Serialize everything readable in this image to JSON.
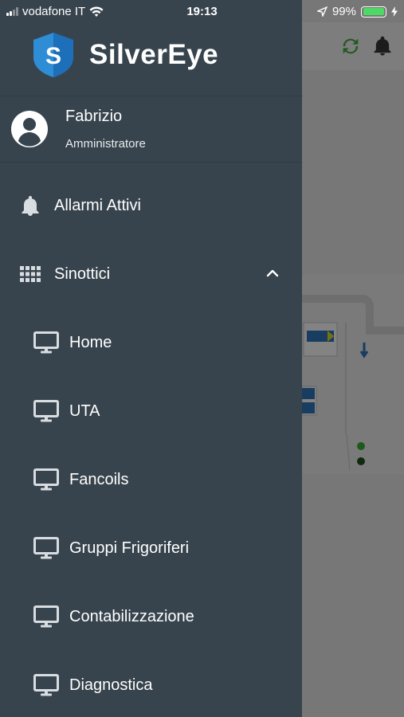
{
  "status_bar": {
    "carrier": "vodafone IT",
    "time": "19:13",
    "battery": "99%",
    "battery_level": 0.99
  },
  "app": {
    "name": "SilverEye",
    "logo_letter": "S"
  },
  "user": {
    "name": "Fabrizio",
    "role": "Amministratore"
  },
  "menu": {
    "alarms": {
      "label": "Allarmi Attivi",
      "icon": "bell-icon"
    },
    "synoptics": {
      "label": "Sinottici",
      "icon": "grid-icon",
      "expanded": true,
      "items": [
        {
          "label": "Home",
          "icon": "monitor-icon"
        },
        {
          "label": "UTA",
          "icon": "monitor-icon"
        },
        {
          "label": "Fancoils",
          "icon": "monitor-icon"
        },
        {
          "label": "Gruppi Frigoriferi",
          "icon": "monitor-icon"
        },
        {
          "label": "Contabilizzazione",
          "icon": "monitor-icon"
        },
        {
          "label": "Diagnostica",
          "icon": "monitor-icon"
        }
      ]
    }
  },
  "colors": {
    "drawer_bg": "#37444d",
    "logo_blue": "#2f8dd6",
    "refresh_green": "#3ca33c",
    "battery_green": "#4cd964"
  }
}
